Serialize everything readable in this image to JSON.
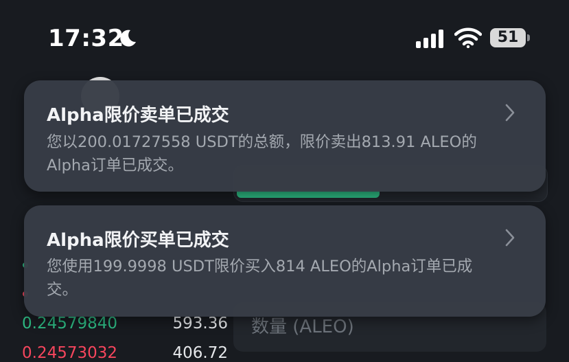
{
  "status_bar": {
    "time": "17:32",
    "battery": "51"
  },
  "background": {
    "quantity_label": "数量 (ALEO)",
    "order_book": [
      {
        "price": "0.24579840",
        "amount": "593.36",
        "side": "buy"
      },
      {
        "price": "0.24573032",
        "amount": "406.72",
        "side": "sell"
      }
    ]
  },
  "notifications": [
    {
      "title": "Alpha限价卖单已成交",
      "body": "您以200.01727558 USDT的总额，限价卖出813.91 ALEO的Alpha订单已成交。"
    },
    {
      "title": "Alpha限价买单已成交",
      "body": "您使用199.9998 USDT限价买入814 ALEO的Alpha订单已成交。"
    }
  ],
  "colors": {
    "background": "#181b20",
    "notification": "#383d46",
    "buy_green": "#2ebd85",
    "sell_red": "#f6465d"
  },
  "icons": [
    "moon-icon",
    "cellular-signal-icon",
    "wifi-icon",
    "battery-icon",
    "chevron-right-icon"
  ]
}
